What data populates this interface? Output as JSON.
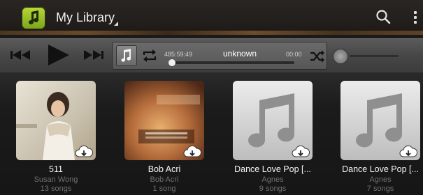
{
  "header": {
    "title": "My Library"
  },
  "player": {
    "time_elapsed": "485:59:49",
    "song_title": "unknown",
    "time_total": "00:00",
    "progress_fraction": 0.0,
    "volume_fraction": 0.0
  },
  "albums": [
    {
      "title": "511",
      "artist": "Susan Wong",
      "songs": "13 songs",
      "cover": "photo"
    },
    {
      "title": "Bob Acri",
      "artist": "Bob Acri",
      "songs": "1 song",
      "cover": "photo"
    },
    {
      "title": "Dance Love Pop [...",
      "artist": "Agnes",
      "songs": "9 songs",
      "cover": "music-note-placeholder"
    },
    {
      "title": "Dance Love Pop [...",
      "artist": "Agnes",
      "songs": "7 songs",
      "cover": "music-note-placeholder"
    }
  ],
  "colors": {
    "accent_green": "#9cc42a",
    "secondary_text": "#6f6f6f"
  }
}
